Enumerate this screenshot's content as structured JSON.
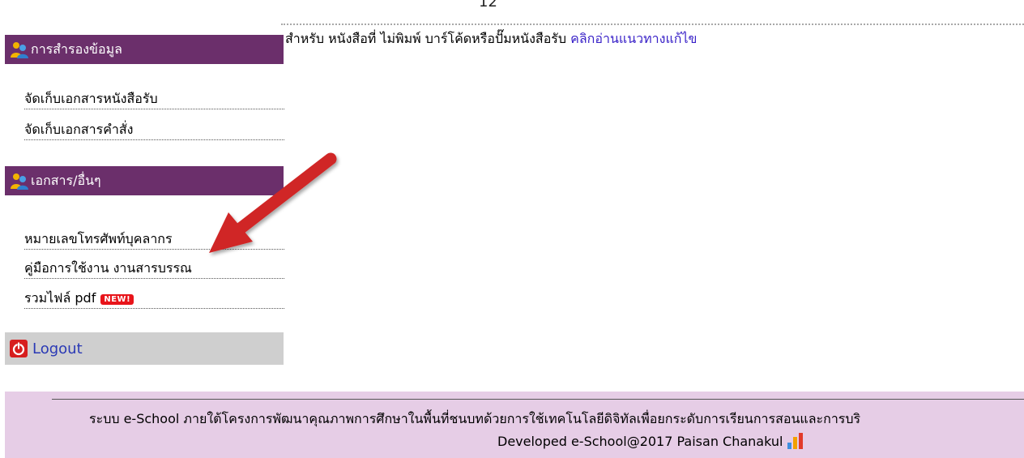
{
  "page": {
    "top_number": "12"
  },
  "sidebar": {
    "sections": [
      {
        "title": "การสำรองข้อมูล",
        "items": [
          "จัดเก็บเอกสารหนังสือรับ",
          "จัดเก็บเอกสารคำสั่ง"
        ]
      },
      {
        "title": "เอกสาร/อื่นๆ",
        "items": [
          "หมายเลขโทรศัพท์บุคลากร",
          "คู่มือการใช้งาน งานสารบรรณ",
          "รวมไฟล์ pdf"
        ],
        "badge": "NEW!"
      }
    ],
    "logout_label": "Logout"
  },
  "notice": {
    "text": "สำหรับ หนังสือที่ ไม่พิมพ์ บาร์โค้ดหรือปั๊มหนังสือรับ",
    "link": "คลิกอ่านแนวทางแก้ไข"
  },
  "footer": {
    "line1": "ระบบ e-School ภายใต้โครงการพัฒนาคุณภาพการศึกษาในพื้นที่ชนบทด้วยการใช้เทคโนโลยีดิจิทัลเพื่อยกระดับการเรียนการสอนและการบริ",
    "line2": "Developed e-School@2017 Paisan Chanakul"
  },
  "icons": {
    "section_header_icon": "people-icon",
    "logout_icon": "power-icon",
    "footer_icon": "bar-chart-icon",
    "annotation": "red-arrow"
  },
  "colors": {
    "section_header_bg": "#6b2f6b",
    "logout_bg": "#cfcfcf",
    "footer_bg": "#e6cde6",
    "link": "#3a23c8",
    "badge": "#e8141a"
  }
}
